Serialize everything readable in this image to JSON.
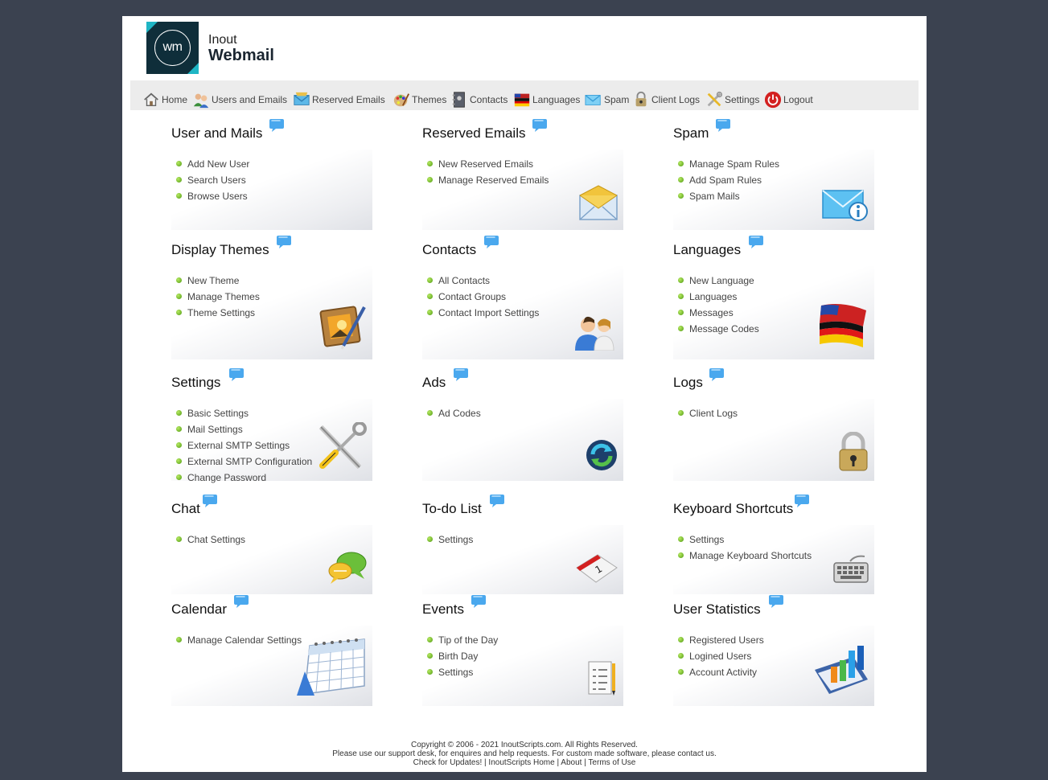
{
  "app": {
    "logo_mark": "wm",
    "logo_line1": "Inout",
    "logo_line2": "Webmail"
  },
  "nav": [
    {
      "label": "Home",
      "icon": "home-icon"
    },
    {
      "label": "Users and Emails",
      "icon": "users-icon"
    },
    {
      "label": "Reserved Emails",
      "icon": "reserved-email-icon"
    },
    {
      "label": "Themes",
      "icon": "palette-icon"
    },
    {
      "label": "Contacts",
      "icon": "contact-book-icon"
    },
    {
      "label": "Languages",
      "icon": "flag-icon"
    },
    {
      "label": "Spam",
      "icon": "spam-mail-icon"
    },
    {
      "label": "Client Logs",
      "icon": "lock-icon"
    },
    {
      "label": "Settings",
      "icon": "tools-icon"
    },
    {
      "label": "Logout",
      "icon": "power-icon"
    }
  ],
  "cards": [
    {
      "title": "User and Mails",
      "icon": "users-icon",
      "links": [
        "Add New User",
        "Search Users",
        "Browse Users"
      ]
    },
    {
      "title": "Reserved Emails",
      "icon": "envelope-icon",
      "links": [
        "New Reserved Emails",
        "Manage Reserved Emails"
      ]
    },
    {
      "title": "Spam",
      "icon": "mail-info-icon",
      "links": [
        "Manage Spam Rules",
        "Add Spam Rules",
        "Spam Mails"
      ]
    },
    {
      "title": "Display Themes",
      "icon": "paint-frame-icon",
      "links": [
        "New Theme",
        "Manage Themes",
        "Theme Settings"
      ]
    },
    {
      "title": "Contacts",
      "icon": "people-icon",
      "links": [
        "All Contacts",
        "Contact Groups",
        "Contact Import Settings"
      ]
    },
    {
      "title": "Languages",
      "icon": "flags-icon",
      "links": [
        "New Language",
        "Languages",
        "Messages",
        "Message Codes"
      ]
    },
    {
      "title": "Settings",
      "icon": "wrench-screwdriver-icon",
      "links": [
        "Basic Settings",
        "Mail Settings",
        "External SMTP Settings",
        "External SMTP Configuration",
        "Change Password"
      ]
    },
    {
      "title": "Ads",
      "icon": "refresh-icon",
      "links": [
        "Ad Codes"
      ]
    },
    {
      "title": "Logs",
      "icon": "padlock-icon",
      "links": [
        "Client Logs"
      ]
    },
    {
      "title": "Chat",
      "icon": "chat-bubbles-icon",
      "links": [
        "Chat Settings"
      ]
    },
    {
      "title": "To-do List",
      "icon": "calendar-page-icon",
      "links": [
        "Settings"
      ]
    },
    {
      "title": "Keyboard Shortcuts",
      "icon": "keyboard-icon",
      "links": [
        "Settings",
        "Manage Keyboard Shortcuts"
      ]
    },
    {
      "title": "Calendar",
      "icon": "calendar-icon",
      "links": [
        "Manage Calendar Settings"
      ]
    },
    {
      "title": "Events",
      "icon": "checklist-icon",
      "links": [
        "Tip of the Day",
        "Birth Day",
        "Settings"
      ]
    },
    {
      "title": "User Statistics",
      "icon": "bar-chart-icon",
      "links": [
        "Registered Users",
        "Logined Users",
        "Account Activity"
      ]
    }
  ],
  "footer": {
    "copyright": "Copyright © 2006 - 2021 InoutScripts.com. All Rights Reserved.",
    "support": "Please use our support desk, for enquires and help requests. For custom made software, please contact us.",
    "links": [
      "Check for Updates!",
      "InoutScripts Home",
      "About",
      "Terms of Use"
    ],
    "separator": " | "
  },
  "colors": {
    "background": "#3b4250",
    "bullet": "#5fae1c",
    "bubble": "#4aa8ee",
    "logo_accent": "#1fb5c4"
  }
}
